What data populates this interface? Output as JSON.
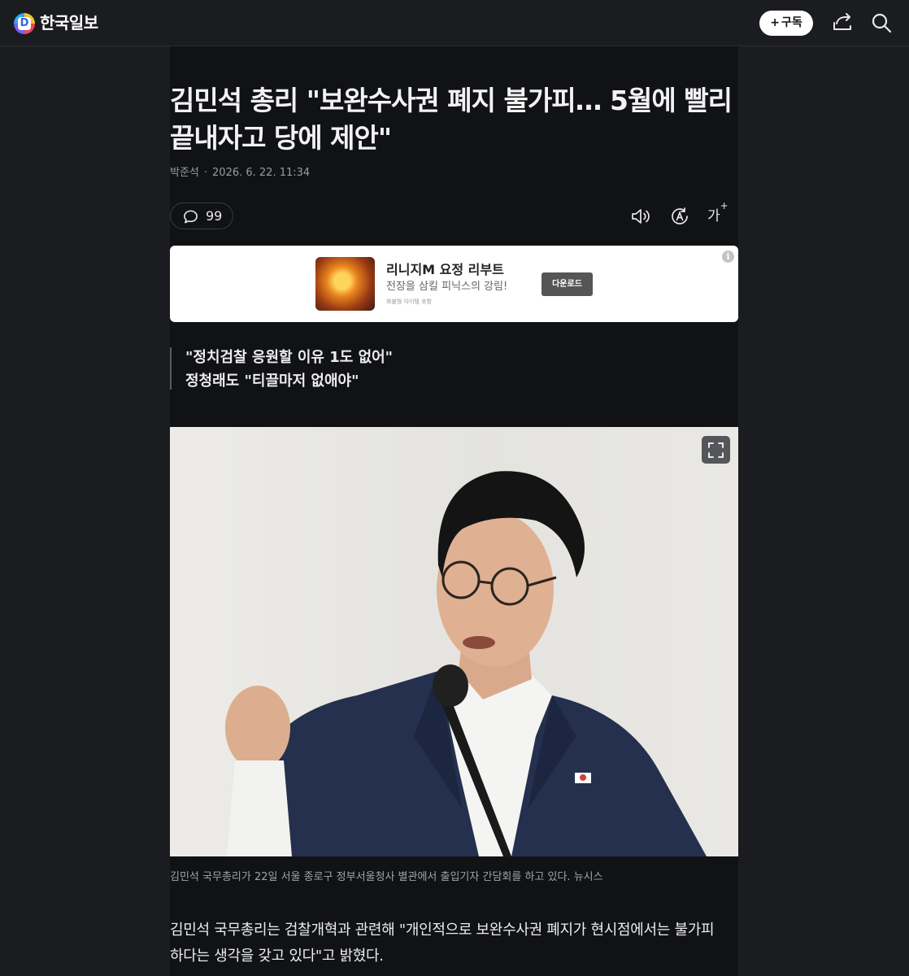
{
  "header": {
    "logo_letter": "D",
    "brand": "한국일보",
    "subscribe_plus": "+",
    "subscribe_label": "구독",
    "share_icon": "share-icon",
    "search_icon": "search-icon"
  },
  "article": {
    "title_line1": "김민석 총리 \"보완수사권 폐지 불가피… 5월에 빨리",
    "title_line2": "끝내자고 당에 제안\"",
    "author": "박준석",
    "dot": "·",
    "date": "2026. 6. 22. 11:34",
    "comment_count": "99",
    "font_tool_label": "가",
    "font_tool_plus": "+",
    "subhead": [
      "\"정치검찰 응원할 이유 1도 없어\"",
      "정청래도 \"티끌마저 없애야\""
    ],
    "caption": "김민석 국무총리가 22일 서울 종로구 정부서울청사 별관에서 출입기자 간담회를 하고 있다. 뉴시스",
    "body_line1": "김민석 국무총리는 검찰개혁과 관련해 \"개인적으로 보완수사권 폐지가 현시점에서는 불가피",
    "body_line2": "하다는 생각을 갖고 있다\"고 밝혔다."
  },
  "ad": {
    "title": "리니지M 요정 리부트",
    "subtitle": "전장을 삼킬 피닉스의 강림!",
    "note": "화불형 아이템 포함",
    "button": "다운로드",
    "info": "i"
  },
  "colors": {
    "background": "#1b1c20",
    "article_bg": "#111214",
    "accent": "#ffffff"
  }
}
